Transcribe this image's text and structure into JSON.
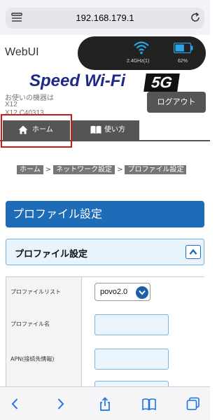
{
  "browser": {
    "url": "192.168.179.1"
  },
  "header": {
    "brand": "WebUI",
    "status": {
      "wifi_band": "2.4GHz(1)",
      "battery_percent": "62%",
      "battery_level": 0.62
    },
    "logo_text": "Speed Wi-Fi",
    "logo_badge": "5G",
    "device_label": "お使いの機器は",
    "device_model": "X12",
    "device_id": "X12 C40313",
    "logout_label": "ログアウト"
  },
  "tabs": [
    {
      "label": "ホーム",
      "icon": "home-icon"
    },
    {
      "label": "使い方",
      "icon": "book-icon"
    }
  ],
  "breadcrumb": {
    "items": [
      "ホーム",
      "ネットワーク設定",
      "プロファイル設定"
    ],
    "separator": ">"
  },
  "page": {
    "title": "プロファイル設定",
    "section_title": "プロファイル設定"
  },
  "form": {
    "rows": [
      {
        "label": "プロファイルリスト",
        "value": "povo2.0"
      },
      {
        "label": "プロファイル名",
        "value": ""
      },
      {
        "label": "APN(接続先情報)",
        "value": ""
      },
      {
        "label": "",
        "value": ""
      }
    ]
  },
  "colors": {
    "primary_blue": "#1e6bb8",
    "tab_gray": "#555555",
    "highlight_red": "#cc1a1a",
    "logo_navy": "#1d2a8a"
  }
}
